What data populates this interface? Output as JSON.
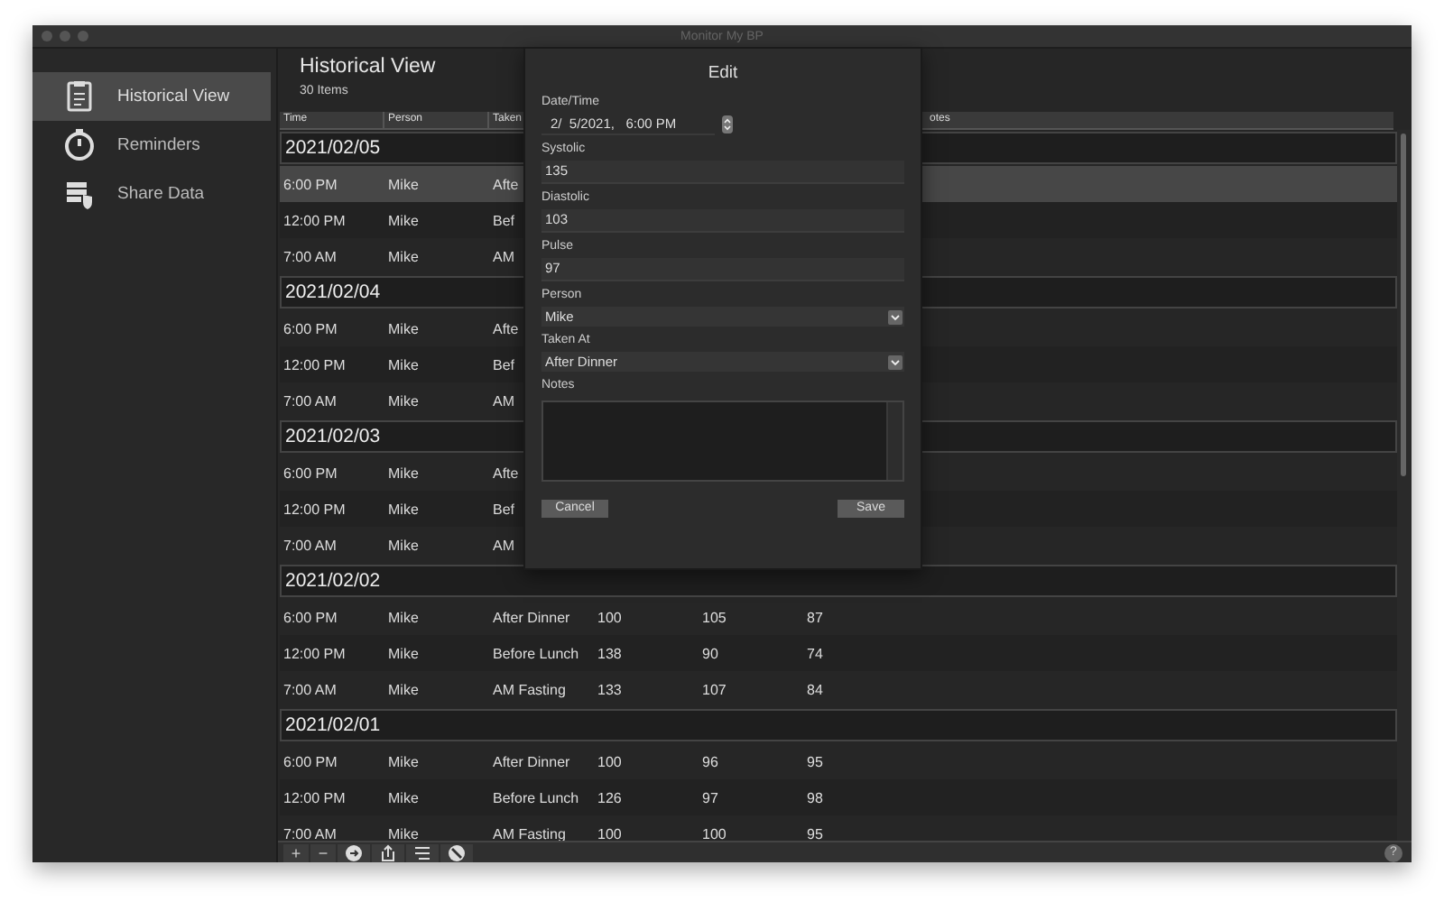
{
  "window": {
    "title": "Monitor My BP"
  },
  "sidebar": {
    "items": [
      {
        "label": "Historical View",
        "kind": "clipboard",
        "selected": true
      },
      {
        "label": "Reminders",
        "kind": "stopwatch",
        "selected": false
      },
      {
        "label": "Share Data",
        "kind": "stack",
        "selected": false
      }
    ]
  },
  "header": {
    "title": "Historical View",
    "count": "30 Items"
  },
  "table": {
    "columns": [
      "Time",
      "Person",
      "Taken"
    ],
    "notes_column": "otes",
    "groups": [
      {
        "date": "2021/02/05",
        "rows": [
          {
            "time": "6:00 PM",
            "person": "Mike",
            "taken_at": "Afte",
            "selected": true
          },
          {
            "time": "12:00 PM",
            "person": "Mike",
            "taken_at": "Bef",
            "selected": false
          },
          {
            "time": "7:00 AM",
            "person": "Mike",
            "taken_at": "AM",
            "selected": false
          }
        ]
      },
      {
        "date": "2021/02/04",
        "rows": [
          {
            "time": "6:00 PM",
            "person": "Mike",
            "taken_at": "Afte",
            "selected": false
          },
          {
            "time": "12:00 PM",
            "person": "Mike",
            "taken_at": "Bef",
            "selected": false
          },
          {
            "time": "7:00 AM",
            "person": "Mike",
            "taken_at": "AM",
            "selected": false
          }
        ]
      },
      {
        "date": "2021/02/03",
        "rows": [
          {
            "time": "6:00 PM",
            "person": "Mike",
            "taken_at": "Afte",
            "selected": false
          },
          {
            "time": "12:00 PM",
            "person": "Mike",
            "taken_at": "Bef",
            "selected": false
          },
          {
            "time": "7:00 AM",
            "person": "Mike",
            "taken_at": "AM",
            "selected": false
          }
        ]
      },
      {
        "date": "2021/02/02",
        "rows": [
          {
            "time": "6:00 PM",
            "person": "Mike",
            "taken_at": "After Dinner",
            "values": [
              "100",
              "105",
              "87"
            ],
            "selected": false
          },
          {
            "time": "12:00 PM",
            "person": "Mike",
            "taken_at": "Before Lunch",
            "values": [
              "138",
              "90",
              "74"
            ],
            "selected": false
          },
          {
            "time": "7:00 AM",
            "person": "Mike",
            "taken_at": "AM Fasting",
            "values": [
              "133",
              "107",
              "84"
            ],
            "selected": false
          }
        ]
      },
      {
        "date": "2021/02/01",
        "rows": [
          {
            "time": "6:00 PM",
            "person": "Mike",
            "taken_at": "After Dinner",
            "values": [
              "100",
              "96",
              "95"
            ],
            "selected": false
          },
          {
            "time": "12:00 PM",
            "person": "Mike",
            "taken_at": "Before Lunch",
            "values": [
              "126",
              "97",
              "98"
            ],
            "selected": false
          },
          {
            "time": "7:00 AM",
            "person": "Mike",
            "taken_at": "AM Fasting",
            "values": [
              "100",
              "100",
              "95"
            ],
            "selected": false
          }
        ]
      }
    ]
  },
  "toolbar": {
    "buttons": [
      {
        "kind": "text",
        "label": "+"
      },
      {
        "kind": "text",
        "label": "−"
      },
      {
        "kind": "circle-arrow"
      },
      {
        "kind": "share"
      },
      {
        "kind": "list"
      },
      {
        "kind": "no-sign"
      }
    ],
    "help": "?"
  },
  "dialog": {
    "title": "Edit",
    "fields": [
      {
        "kind": "datetime",
        "label": "Date/Time",
        "value": "2/  5/2021,   6:00 PM"
      },
      {
        "kind": "text",
        "label": "Systolic",
        "value": "135"
      },
      {
        "kind": "text",
        "label": "Diastolic",
        "value": "103"
      },
      {
        "kind": "text",
        "label": "Pulse",
        "value": "97"
      },
      {
        "kind": "select",
        "label": "Person",
        "value": "Mike"
      },
      {
        "kind": "select",
        "label": "Taken At",
        "value": "After Dinner"
      },
      {
        "kind": "textarea",
        "label": "Notes"
      }
    ],
    "buttons": [
      "Cancel",
      "Save"
    ]
  }
}
